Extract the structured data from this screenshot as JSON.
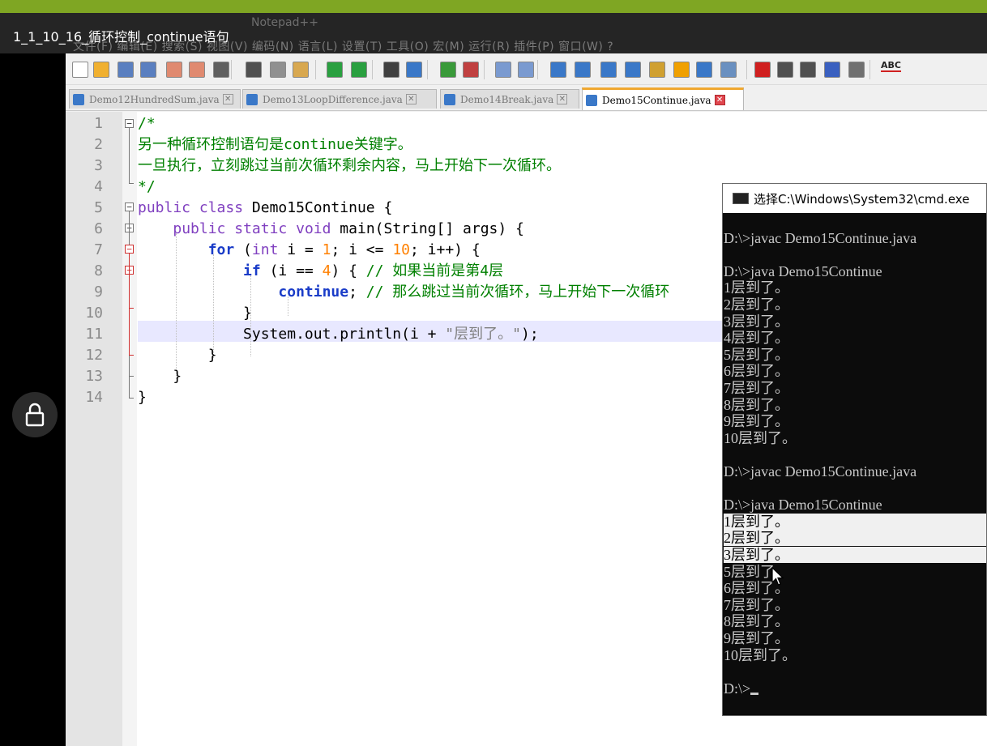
{
  "video": {
    "title": "1_1_10_16_循环控制_continue语句",
    "ghost_menu": "文件(F)  编辑(E)  搜索(S)  视图(V)  编码(N)  语言(L)  设置(T)  工具(O)  宏(M)  运行(R)  插件(P)  窗口(W)  ?",
    "ghost_title": "Notepad++"
  },
  "toolbar": {
    "icons": [
      "new-file-icon",
      "open-file-icon",
      "save-icon",
      "save-all-icon",
      "close-icon",
      "close-all-icon",
      "print-icon",
      "cut-icon",
      "copy-icon",
      "paste-icon",
      "undo-icon",
      "redo-icon",
      "find-icon",
      "replace-icon",
      "zoom-in-icon",
      "zoom-out-icon",
      "sync-v-icon",
      "sync-h-icon",
      "wrap-icon",
      "show-all-chars-icon",
      "indent-guide-icon",
      "doc-map-icon",
      "function-list-icon",
      "folder-workspace-icon",
      "monitor-icon",
      "eye-icon",
      "record-macro-icon",
      "stop-macro-icon",
      "play-macro-icon",
      "run-macro-multiple-icon",
      "save-macro-icon",
      "spellcheck-icon"
    ],
    "spellcheck_label": "ABC"
  },
  "tabs": [
    {
      "label": "Demo12HundredSum.java",
      "active": false
    },
    {
      "label": "Demo13LoopDifference.java",
      "active": false
    },
    {
      "label": "Demo14Break.java",
      "active": false
    },
    {
      "label": "Demo15Continue.java",
      "active": true
    }
  ],
  "editor": {
    "line_numbers": [
      "1",
      "2",
      "3",
      "4",
      "5",
      "6",
      "7",
      "8",
      "9",
      "10",
      "11",
      "12",
      "13",
      "14"
    ],
    "lines": {
      "l1": "/*",
      "l2": "另一种循环控制语句是continue关键字。",
      "l3": "一旦执行，立刻跳过当前次循环剩余内容，马上开始下一次循环。",
      "l4": "*/",
      "l5_kw1": "public",
      "l5_kw2": "class",
      "l5_name": " Demo15Continue {",
      "l6_kw1": "public",
      "l6_kw2": "static",
      "l6_kw3": "void",
      "l6_rest": " main(String[] args) {",
      "l7_kw": "for",
      "l7_a": " (",
      "l7_ty": "int",
      "l7_b": " i = ",
      "l7_n1": "1",
      "l7_c": "; i <= ",
      "l7_n2": "10",
      "l7_d": "; i++) {",
      "l8_kw": "if",
      "l8_a": " (i == ",
      "l8_n": "4",
      "l8_b": ") { ",
      "l8_cmt": "// 如果当前是第4层",
      "l9_kw": "continue",
      "l9_a": "; ",
      "l9_cmt": "// 那么跳过当前次循环，马上开始下一次循环",
      "l10": "}",
      "l11_a": "System.out.println(i + ",
      "l11_str": "\"层到了。\"",
      "l11_b": ");",
      "l12": "}",
      "l13": "}",
      "l14": "}"
    }
  },
  "cmd": {
    "title": "选择C:\\Windows\\System32\\cmd.exe",
    "lines": [
      "",
      "D:\\>javac Demo15Continue.java",
      "",
      "D:\\>java Demo15Continue",
      "1层到了。",
      "2层到了。",
      "3层到了。",
      "4层到了。",
      "5层到了。",
      "6层到了。",
      "7层到了。",
      "8层到了。",
      "9层到了。",
      "10层到了。",
      "",
      "D:\\>javac Demo15Continue.java",
      "",
      "D:\\>java Demo15Continue",
      "1层到了。",
      "2层到了。",
      "3层到了。",
      "5层到了。",
      "6层到了。",
      "7层到了。",
      "8层到了。",
      "9层到了。",
      "10层到了。",
      "",
      "D:\\>"
    ]
  }
}
